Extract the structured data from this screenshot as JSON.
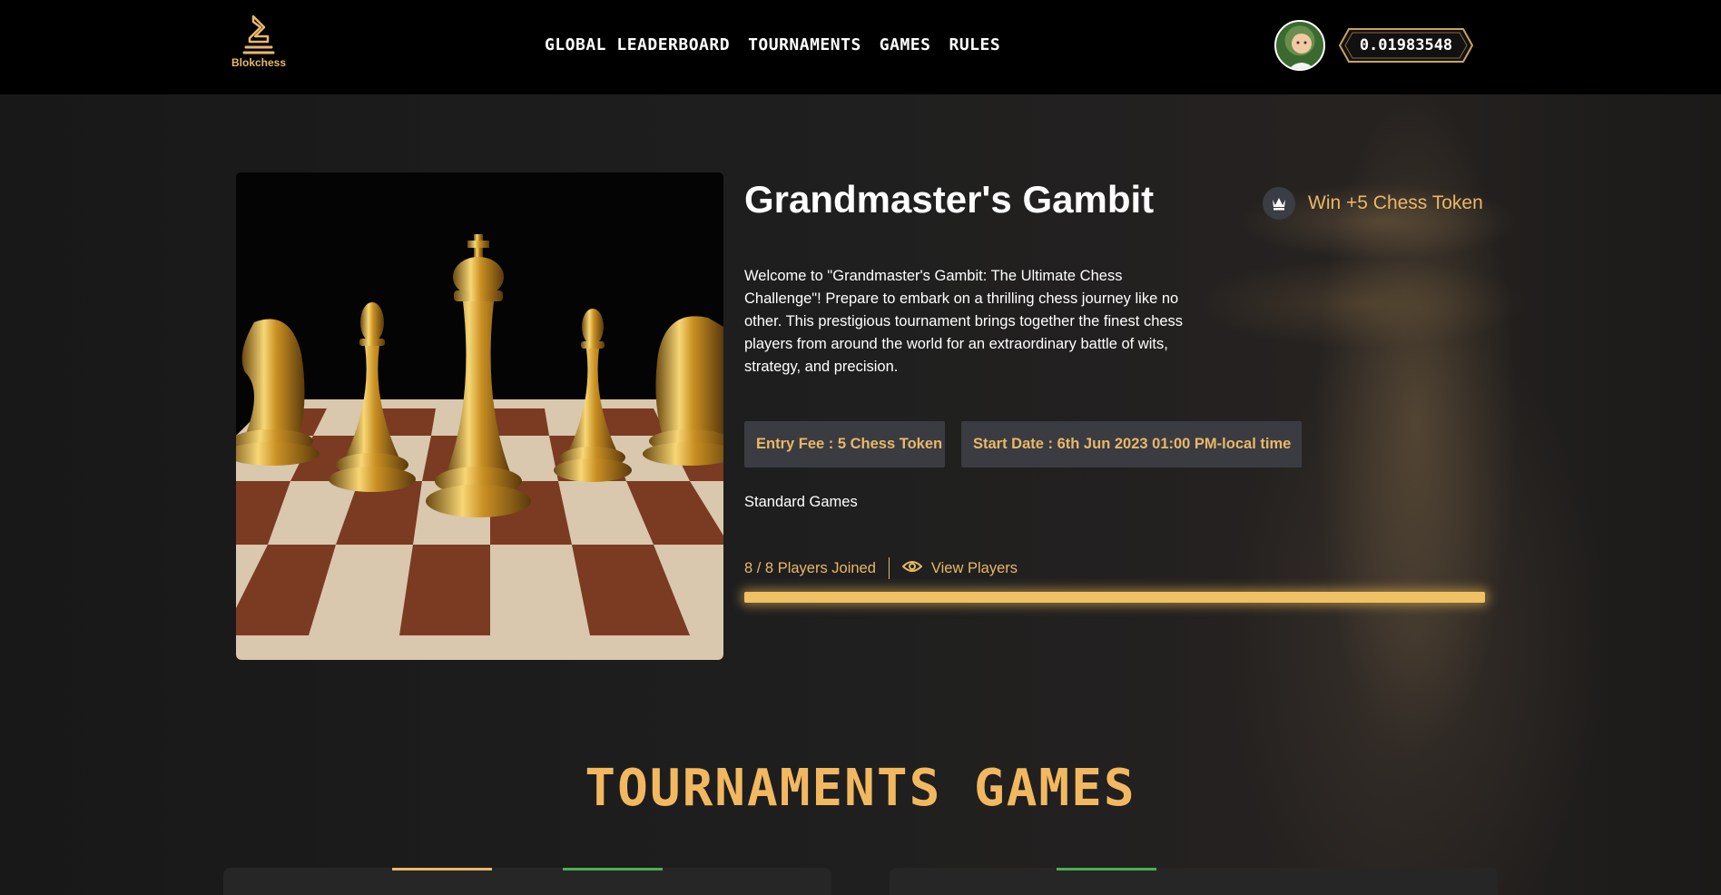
{
  "brand": {
    "name": "Blokchess",
    "accent": "#e9b866"
  },
  "nav": {
    "links": [
      "Global Leaderboard",
      "Tournaments",
      "Games",
      "Rules"
    ]
  },
  "user": {
    "balance": "0.01983548"
  },
  "tournament": {
    "title": "Grandmaster's Gambit",
    "reward": "Win +5 Chess Token",
    "description": "Welcome to \"Grandmaster's Gambit: The Ultimate Chess Challenge\"! Prepare to embark on a thrilling chess journey like no other. This prestigious tournament brings together the finest chess players from around the world for an extraordinary battle of wits, strategy, and precision.",
    "entry_fee": "Entry Fee : 5 Chess Token",
    "start_date": "Start Date : 6th Jun 2023 01:00 PM-local time",
    "game_type": "Standard Games",
    "players_joined": "8 / 8 Players Joined",
    "view_players": "View Players",
    "progress": 1.0
  },
  "section": {
    "title": "Tournaments Games"
  },
  "icons": {
    "reward": "queen-icon",
    "view": "eye-icon"
  }
}
